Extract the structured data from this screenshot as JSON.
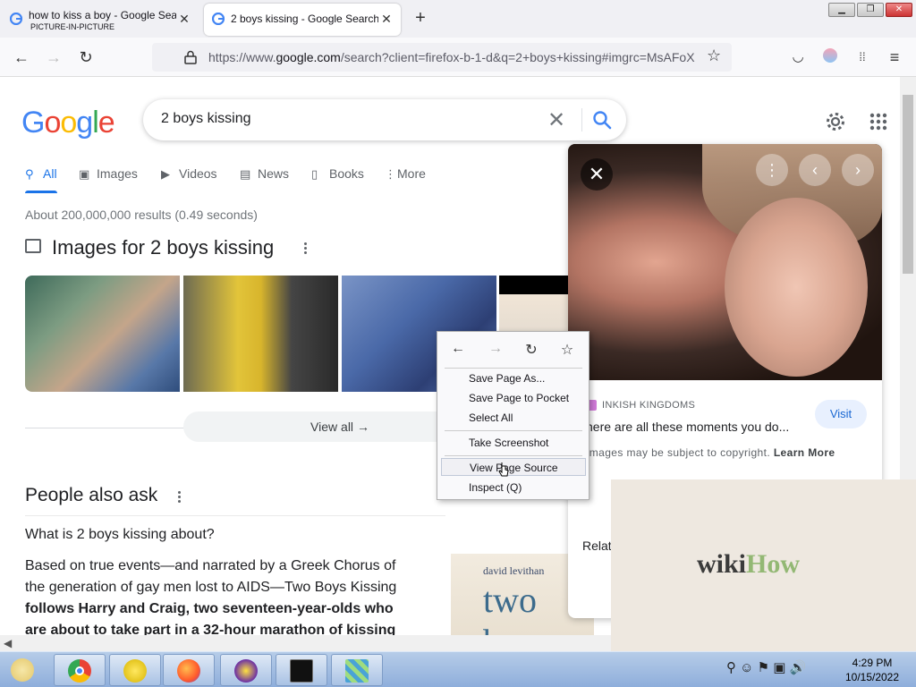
{
  "browser": {
    "tabs": [
      {
        "title": "how to kiss a boy - Google Search",
        "subtitle": "PICTURE-IN-PICTURE"
      },
      {
        "title": "2 boys kissing - Google Search"
      }
    ],
    "url_prefix": "https://www.",
    "url_domain": "google.com",
    "url_rest": "/search?client=firefox-b-1-d&q=2+boys+kissing#imgrc=MsAFoX"
  },
  "google": {
    "logo": [
      "G",
      "o",
      "o",
      "g",
      "l",
      "e"
    ],
    "logo_colors": [
      "#4285f4",
      "#ea4335",
      "#fbbc05",
      "#4285f4",
      "#34a853",
      "#ea4335"
    ],
    "query": "2 boys kissing",
    "tabs": [
      "All",
      "Images",
      "Videos",
      "News",
      "Books",
      "More"
    ],
    "stats": "About 200,000,000 results (0.49 seconds)",
    "images_heading": "Images for 2 boys kissing",
    "view_all": "View all",
    "paa_heading": "People also ask",
    "question": "What is 2 boys kissing about?",
    "answer_plain": "Based on true events—and narrated by a Greek Chorus of the generation of gay men lost to AIDS—Two Boys Kissing ",
    "answer_bold": "follows Harry and Craig, two seventeen-year-olds who are about to take part in a 32-hour marathon of kissing",
    "book_author": "david levithan",
    "book_title": "two boys"
  },
  "panel": {
    "source": "INKISH KINGDOMS",
    "title": "here are all these moments you do...",
    "visit": "Visit",
    "copyright": "Images may be subject to copyright.",
    "learn_more": "Learn More",
    "related": "Relat"
  },
  "wikihow": {
    "part1": "wiki",
    "part2": "How"
  },
  "context_menu": {
    "items": [
      "Save Page As...",
      "Save Page to Pocket",
      "Select All",
      "Take Screenshot",
      "View Page Source",
      "Inspect (Q)"
    ],
    "highlighted": "View Page Source"
  },
  "taskbar": {
    "time": "4:29 PM",
    "date": "10/15/2022"
  }
}
